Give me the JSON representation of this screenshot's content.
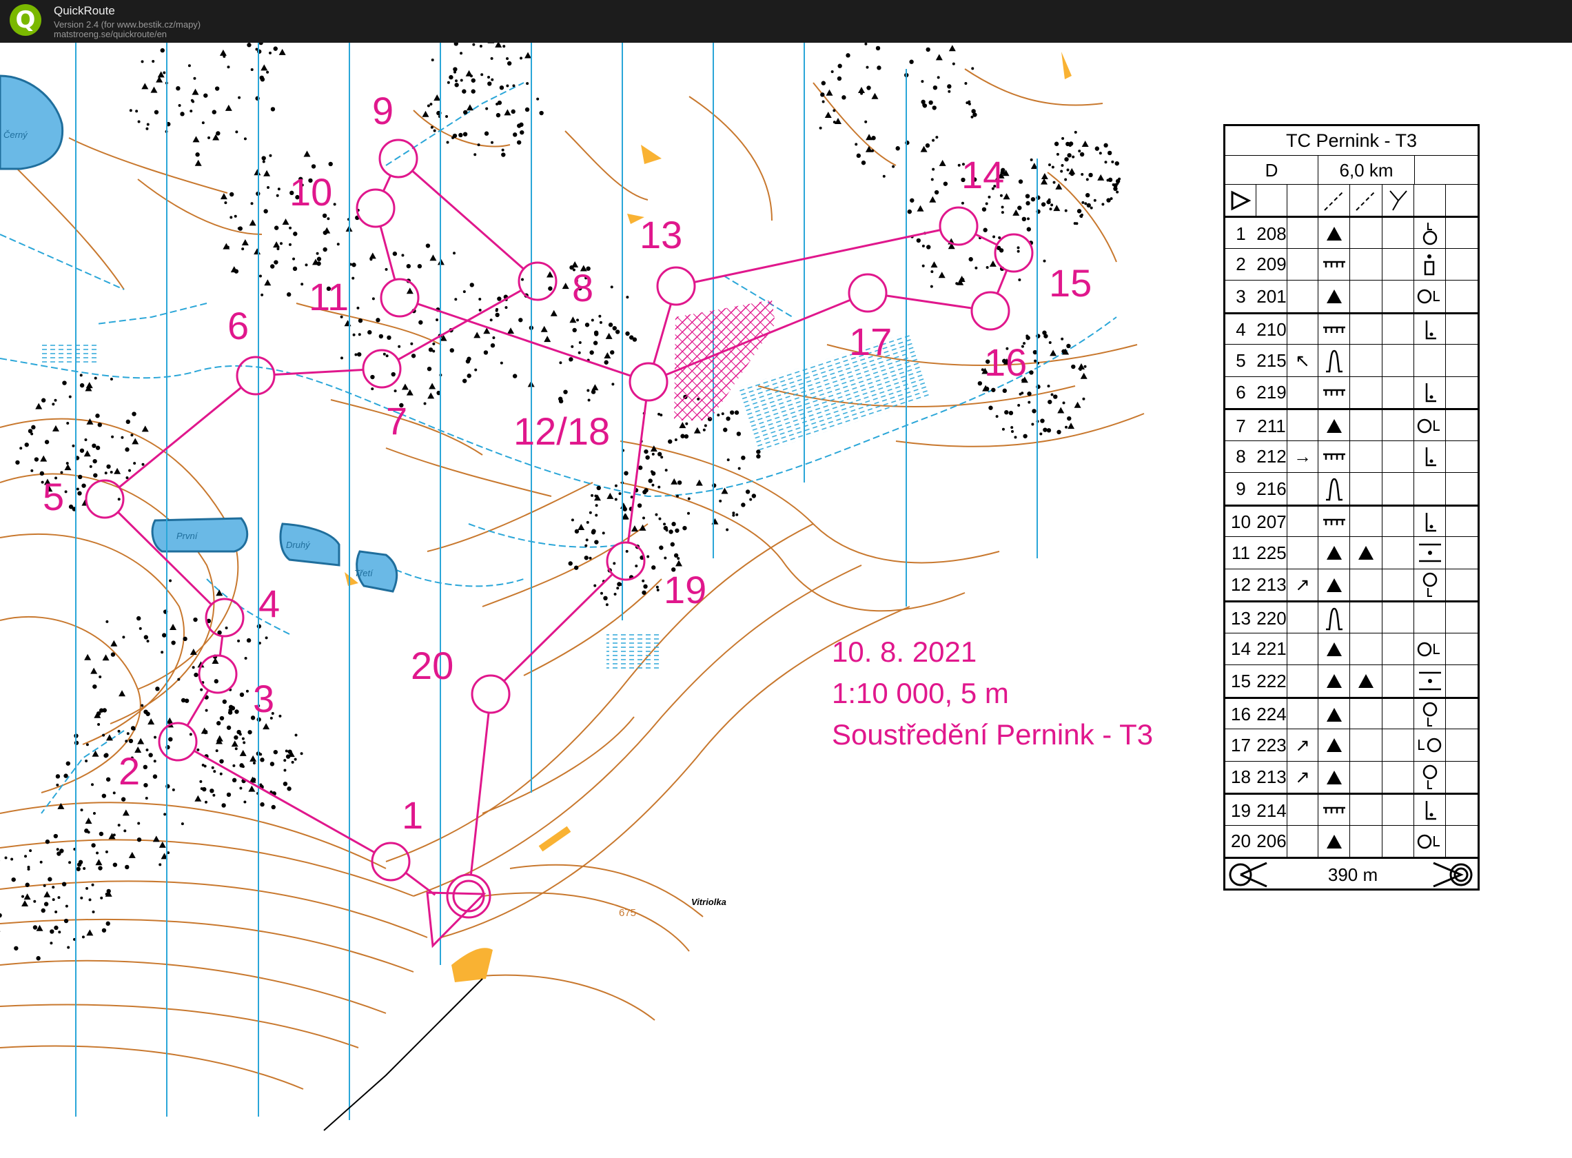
{
  "window": {
    "title": "QuickRoute",
    "version_line": "Version 2.4  (for www.bestik.cz/mapy)",
    "url_line": "matstroeng.se/quickroute/en",
    "close_glyph": "×"
  },
  "map": {
    "place_labels": [
      "Černý",
      "První",
      "Druhý",
      "Třetí",
      "Vitriolka"
    ],
    "contour_label": "675",
    "course_color": "#e0178c",
    "control_labels": [
      "1",
      "2",
      "3",
      "4",
      "5",
      "6",
      "7",
      "8",
      "9",
      "10",
      "11",
      "12/18",
      "13",
      "14",
      "15",
      "16",
      "17",
      "19",
      "20"
    ],
    "info": {
      "date": "10. 8. 2021",
      "scale": "1:10 000, 5 m",
      "event": "Soustředění Pernink - T3"
    }
  },
  "description_sheet": {
    "title": "TC Pernink - T3",
    "category": "D",
    "length": "6,0 km",
    "rows": [
      {
        "num": "1",
        "code": "208",
        "dir": "",
        "feature": "▲",
        "feature2": "",
        "pos": "top"
      },
      {
        "num": "2",
        "code": "209",
        "dir": "",
        "feature": "cliff",
        "feature2": "",
        "pos": "top-foot"
      },
      {
        "num": "3",
        "code": "201",
        "dir": "",
        "feature": "▲",
        "feature2": "",
        "pos": "o-L"
      },
      {
        "num": "4",
        "code": "210",
        "dir": "",
        "feature": "cliff",
        "feature2": "",
        "pos": "foot"
      },
      {
        "num": "5",
        "code": "215",
        "dir": "↖",
        "feature": "knoll",
        "feature2": "",
        "pos": ""
      },
      {
        "num": "6",
        "code": "219",
        "dir": "",
        "feature": "cliff",
        "feature2": "",
        "pos": "foot"
      },
      {
        "num": "7",
        "code": "211",
        "dir": "",
        "feature": "▲",
        "feature2": "",
        "pos": "o-L"
      },
      {
        "num": "8",
        "code": "212",
        "dir": "→",
        "feature": "cliff",
        "feature2": "",
        "pos": "foot"
      },
      {
        "num": "9",
        "code": "216",
        "dir": "",
        "feature": "knoll",
        "feature2": "",
        "pos": ""
      },
      {
        "num": "10",
        "code": "207",
        "dir": "",
        "feature": "cliff",
        "feature2": "",
        "pos": "foot"
      },
      {
        "num": "11",
        "code": "225",
        "dir": "",
        "feature": "▲",
        "feature2": "▲",
        "pos": "between"
      },
      {
        "num": "12",
        "code": "213",
        "dir": "↗",
        "feature": "▲",
        "feature2": "",
        "pos": "o-bottom"
      },
      {
        "num": "13",
        "code": "220",
        "dir": "",
        "feature": "knoll",
        "feature2": "",
        "pos": ""
      },
      {
        "num": "14",
        "code": "221",
        "dir": "",
        "feature": "▲",
        "feature2": "",
        "pos": "o-L"
      },
      {
        "num": "15",
        "code": "222",
        "dir": "",
        "feature": "▲",
        "feature2": "▲",
        "pos": "between"
      },
      {
        "num": "16",
        "code": "224",
        "dir": "",
        "feature": "▲",
        "feature2": "",
        "pos": "o-bottom"
      },
      {
        "num": "17",
        "code": "223",
        "dir": "↗",
        "feature": "▲",
        "feature2": "",
        "pos": "L-o"
      },
      {
        "num": "18",
        "code": "213",
        "dir": "↗",
        "feature": "▲",
        "feature2": "",
        "pos": "o-bottom"
      },
      {
        "num": "19",
        "code": "214",
        "dir": "",
        "feature": "cliff",
        "feature2": "",
        "pos": "foot"
      },
      {
        "num": "20",
        "code": "206",
        "dir": "",
        "feature": "▲",
        "feature2": "",
        "pos": "o-L"
      }
    ],
    "finish_distance": "390 m"
  }
}
